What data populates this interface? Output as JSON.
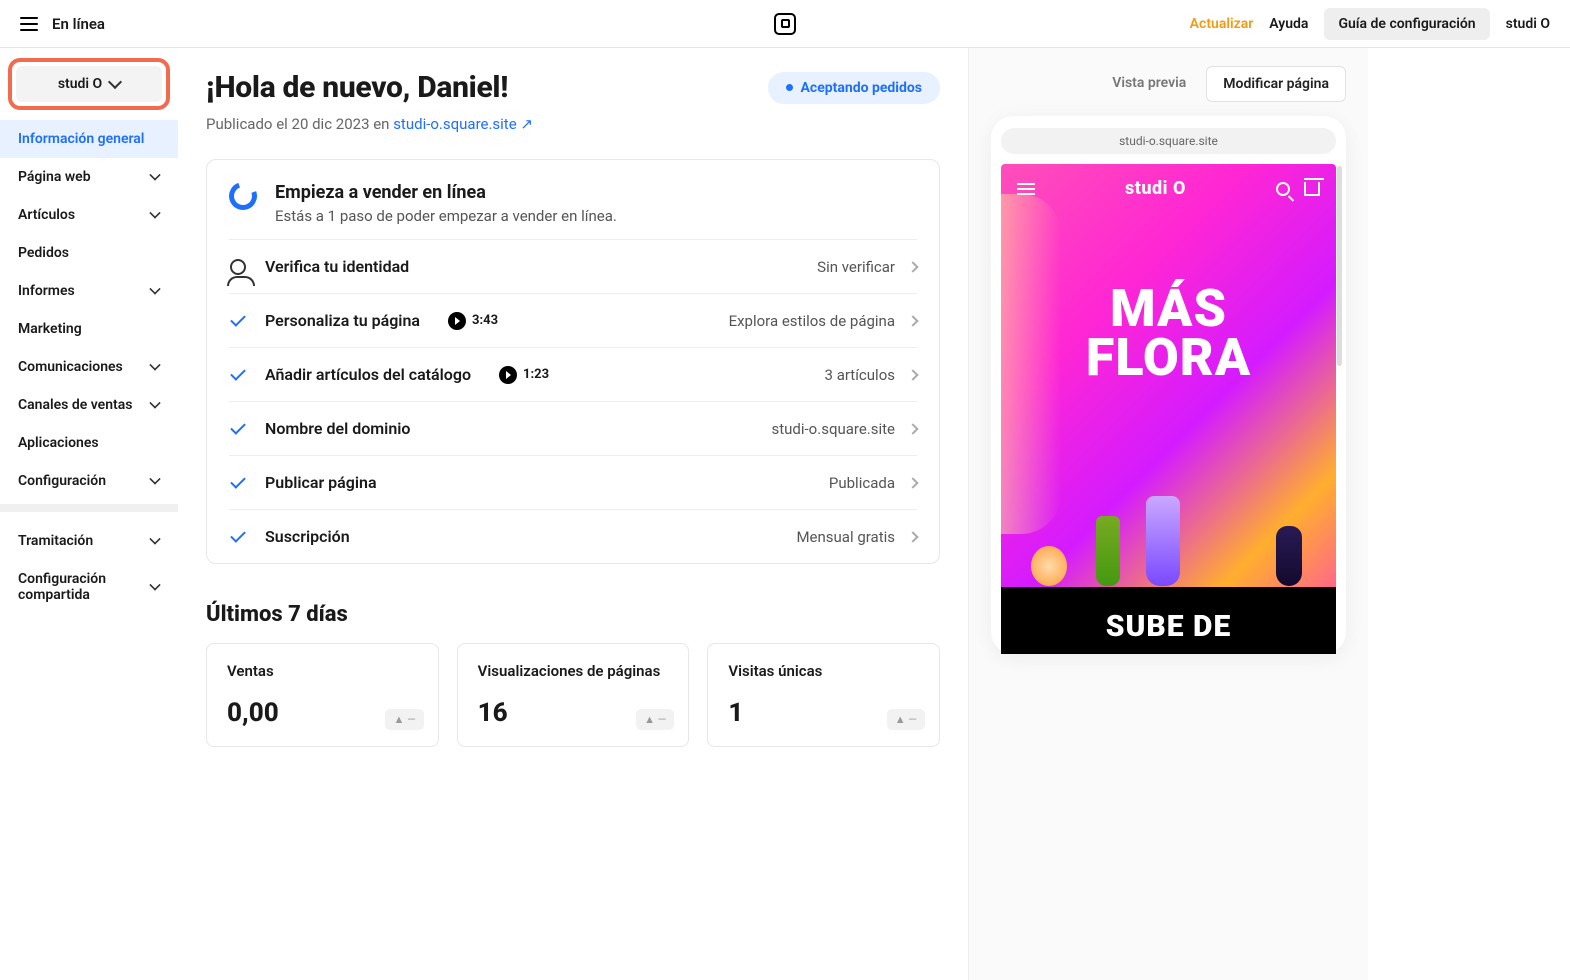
{
  "topbar": {
    "title": "En línea",
    "update": "Actualizar",
    "help": "Ayuda",
    "guide": "Guía de configuración",
    "account": "studi O"
  },
  "sidebar": {
    "siteName": "studi O",
    "items": [
      {
        "label": "Información general",
        "active": true,
        "sub": false
      },
      {
        "label": "Página web",
        "active": false,
        "sub": true
      },
      {
        "label": "Artículos",
        "active": false,
        "sub": true
      },
      {
        "label": "Pedidos",
        "active": false,
        "sub": false
      },
      {
        "label": "Informes",
        "active": false,
        "sub": true
      },
      {
        "label": "Marketing",
        "active": false,
        "sub": false
      },
      {
        "label": "Comunicaciones",
        "active": false,
        "sub": true
      },
      {
        "label": "Canales de ventas",
        "active": false,
        "sub": true
      },
      {
        "label": "Aplicaciones",
        "active": false,
        "sub": false
      },
      {
        "label": "Configuración",
        "active": false,
        "sub": true
      }
    ],
    "lower": [
      {
        "label": "Tramitación",
        "sub": true
      },
      {
        "label": "Configuración compartida",
        "sub": true
      }
    ]
  },
  "main": {
    "greeting": "¡Hola de nuevo, Daniel!",
    "statusPill": "Aceptando pedidos",
    "publishedPrefix": "Publicado el 20 dic 2023 en ",
    "siteUrl": "studi-o.square.site",
    "arrow": "↗",
    "onboard": {
      "title": "Empieza a vender en línea",
      "subtitle": "Estás a 1 paso de poder empezar a vender en línea."
    },
    "tasks": [
      {
        "done": false,
        "icon": "person",
        "title": "Verifica tu identidad",
        "meta": "Sin verificar"
      },
      {
        "done": true,
        "title": "Personaliza tu página",
        "video": "3:43",
        "meta": "Explora estilos de página"
      },
      {
        "done": true,
        "title": "Añadir artículos del catálogo",
        "video": "1:23",
        "meta": "3 artículos"
      },
      {
        "done": true,
        "title": "Nombre del dominio",
        "meta": "studi-o.square.site"
      },
      {
        "done": true,
        "title": "Publicar página",
        "meta": "Publicada"
      },
      {
        "done": true,
        "title": "Suscripción",
        "meta": "Mensual gratis"
      }
    ],
    "statsTitle": "Últimos 7 días",
    "stats": [
      {
        "label": "Ventas",
        "value": "0,00"
      },
      {
        "label": "Visualizaciones de páginas",
        "value": "16"
      },
      {
        "label": "Visitas únicas",
        "value": "1"
      }
    ],
    "trendGlyph": "▲ —"
  },
  "preview": {
    "tabPreview": "Vista previa",
    "tabEdit": "Modificar página",
    "url": "studi-o.square.site",
    "siteLogo": "studi O",
    "heroLine1": "MÁS",
    "heroLine2": "FLORA",
    "band": "SUBE DE"
  }
}
